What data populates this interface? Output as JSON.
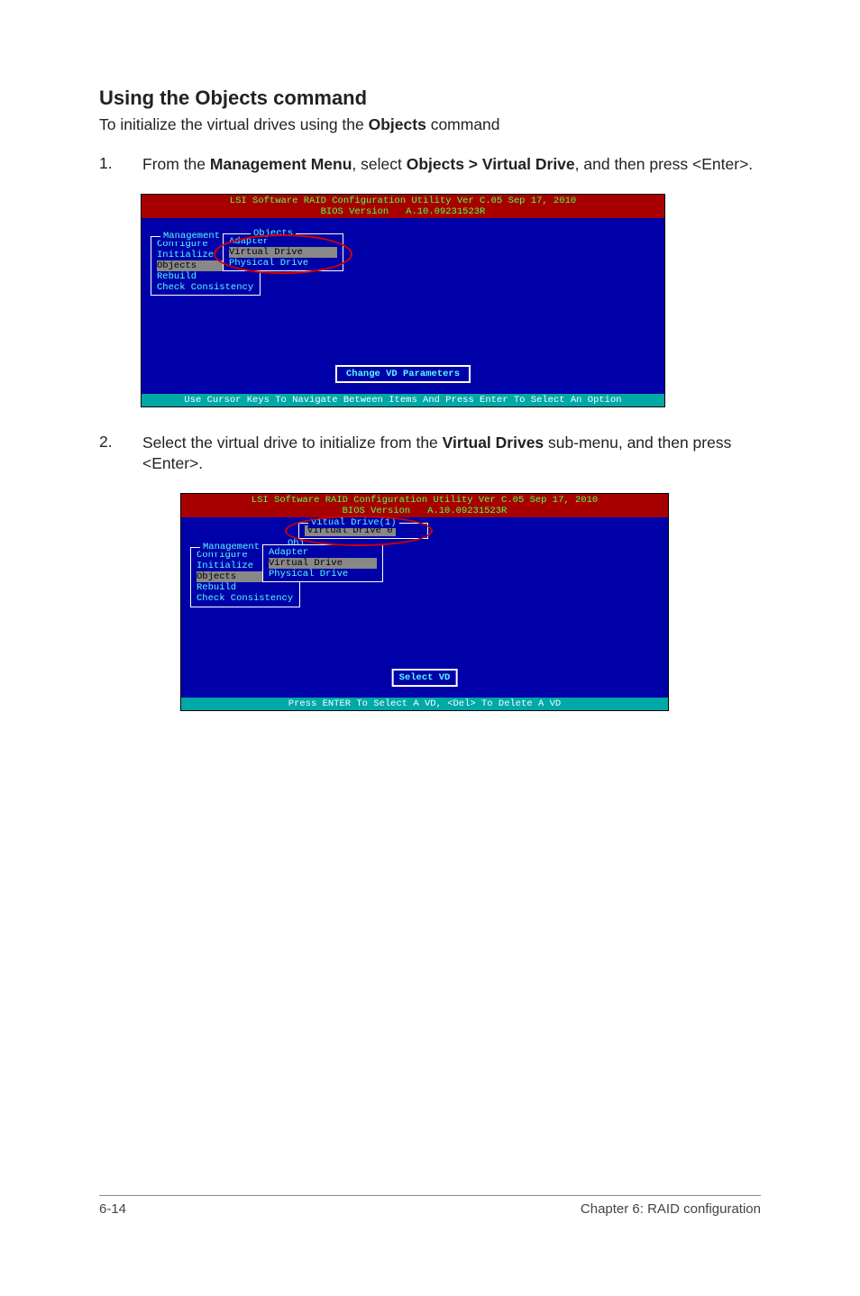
{
  "section_title": "Using the Objects command",
  "lead_prefix": "To initialize the virtual drives using the ",
  "lead_bold": "Objects",
  "lead_suffix": " command",
  "step1": {
    "num": "1.",
    "t1": "From the ",
    "b1": "Management Menu",
    "t2": ", select ",
    "b2": "Objects > Virtual Drive",
    "t3": ", and then press <Enter>."
  },
  "step2": {
    "num": "2.",
    "t1": "Select the virtual drive to initialize from the ",
    "b1": "Virtual Drives",
    "t2": " sub-menu, and then press <Enter>."
  },
  "bios_common": {
    "title_line1": "LSI Software RAID Configuration Utility Ver C.05 Sep 17, 2010",
    "title_line2": "BIOS Version   A.10.09231523R",
    "mgmt_label": "Management",
    "mgmt_items": [
      "Configure",
      "Initialize",
      "Objects",
      "Rebuild",
      "Check Consistency"
    ]
  },
  "bios1": {
    "objects_label": "Objects",
    "objects_items": [
      "Adapter",
      "Virtual Drive",
      "Physical Drive"
    ],
    "hint": "Change VD Parameters",
    "footer": "Use Cursor Keys To Navigate Between Items And Press Enter To Select An Option"
  },
  "bios2": {
    "obj_short": "Obj",
    "objects_items": [
      "Adapter",
      "Virtual Drive",
      "Physical Drive"
    ],
    "vd_label": "Vitual Drive(1)",
    "vd_item": "Virtual Drive 0",
    "hint": "Select VD",
    "footer": "Press ENTER To Select A VD, <Del> To Delete A VD"
  },
  "footer": {
    "left": "6-14",
    "right": "Chapter 6: RAID configuration"
  }
}
